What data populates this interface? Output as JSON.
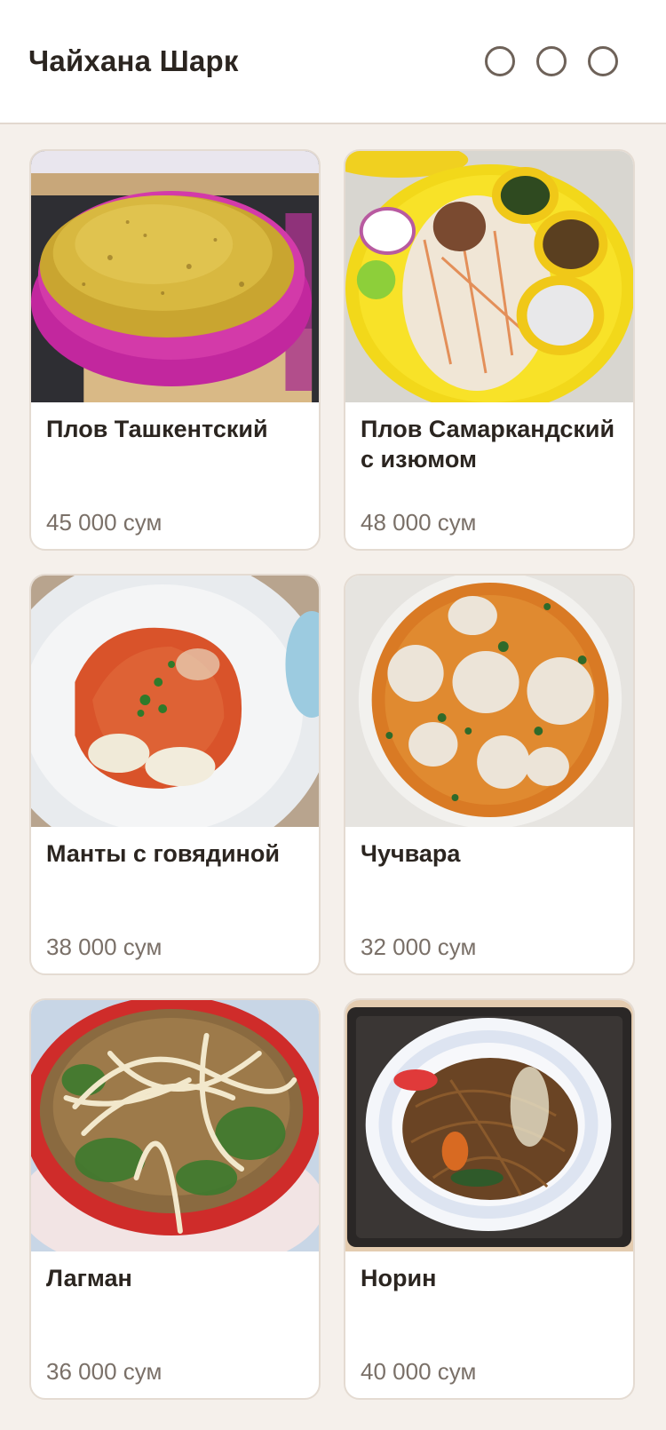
{
  "header": {
    "title": "Чайхана Шарк",
    "actions": [
      "action-1",
      "action-2",
      "action-3"
    ]
  },
  "menu": {
    "items": [
      {
        "name": "Плов Ташкентский",
        "price": "45 000 сум",
        "image": "plov-tashkent"
      },
      {
        "name": "Плов Самаркандский с изюмом",
        "price": "48 000 сум",
        "image": "plov-samarkand"
      },
      {
        "name": "Манты с говядиной",
        "price": "38 000 сум",
        "image": "manty"
      },
      {
        "name": "Чучвара",
        "price": "32 000 сум",
        "image": "chuchvara"
      },
      {
        "name": "Лагман",
        "price": "36 000 сум",
        "image": "lagman"
      },
      {
        "name": "Норин",
        "price": "40 000 сум",
        "image": "norin"
      }
    ]
  },
  "colors": {
    "background": "#f5f0eb",
    "card": "#ffffff",
    "title": "#2b2520",
    "price": "#7a7068",
    "border": "#e4dbd2"
  }
}
